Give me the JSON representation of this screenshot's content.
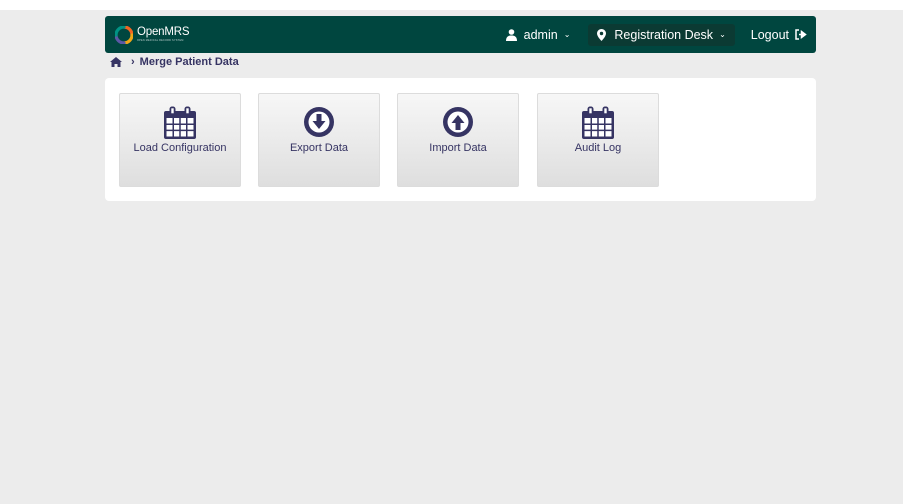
{
  "brand": {
    "name": "OpenMRS",
    "tagline": "OPEN MEDICAL RECORD SYSTEM"
  },
  "header": {
    "user": {
      "label": "admin",
      "caret": "⌄"
    },
    "location": {
      "label": "Registration Desk",
      "caret": "⌄"
    },
    "logout": {
      "label": "Logout"
    }
  },
  "breadcrumb": {
    "separator": "›",
    "current": "Merge Patient Data"
  },
  "tiles": [
    {
      "label": "Load Configuration",
      "icon": "calendar-icon"
    },
    {
      "label": "Export Data",
      "icon": "arrow-circle-down-icon"
    },
    {
      "label": "Import Data",
      "icon": "arrow-circle-up-icon"
    },
    {
      "label": "Audit Log",
      "icon": "calendar-icon"
    }
  ],
  "colors": {
    "header_bg": "#00463f",
    "accent_text": "#363463",
    "page_bg": "#ececec",
    "panel_bg": "#ffffff"
  }
}
